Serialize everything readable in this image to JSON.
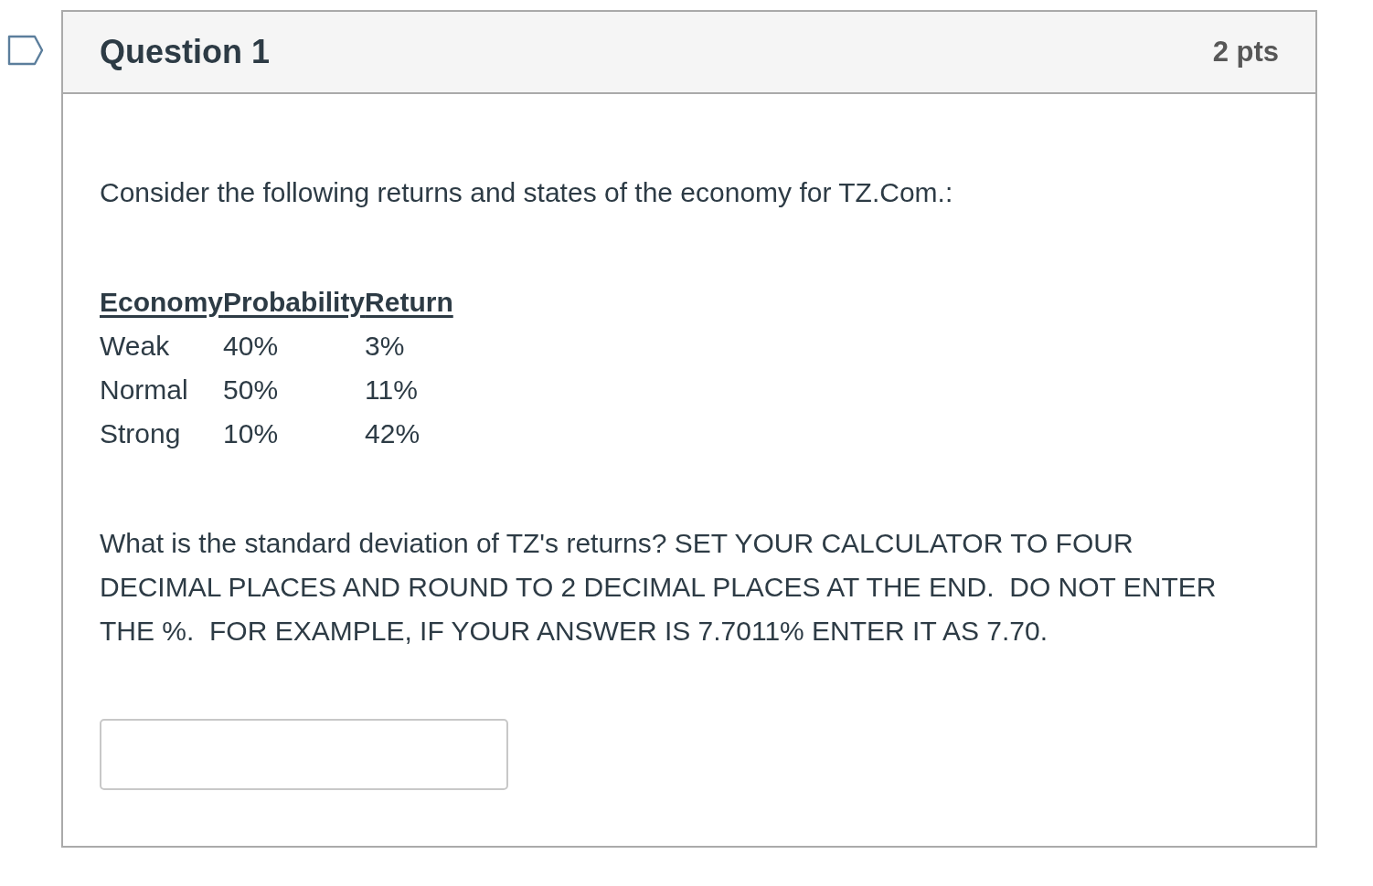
{
  "question": {
    "title": "Question 1",
    "points": "2 pts",
    "flagged": false
  },
  "intro": "Consider the following returns and states of the economy for TZ.Com.:",
  "table": {
    "columns": [
      "Economy",
      "Probability",
      "Return"
    ],
    "rows": [
      [
        "Weak",
        "40%",
        "3%"
      ],
      [
        "Normal",
        "50%",
        "11%"
      ],
      [
        "Strong",
        "10%",
        "42%"
      ]
    ]
  },
  "prompt": "What is the standard deviation of TZ's returns? SET YOUR CALCULATOR TO FOUR DECIMAL PLACES AND ROUND TO 2 DECIMAL PLACES AT THE END.  DO NOT ENTER THE %.  FOR EXAMPLE, IF YOUR ANSWER IS 7.7011% ENTER IT AS 7.70."
}
